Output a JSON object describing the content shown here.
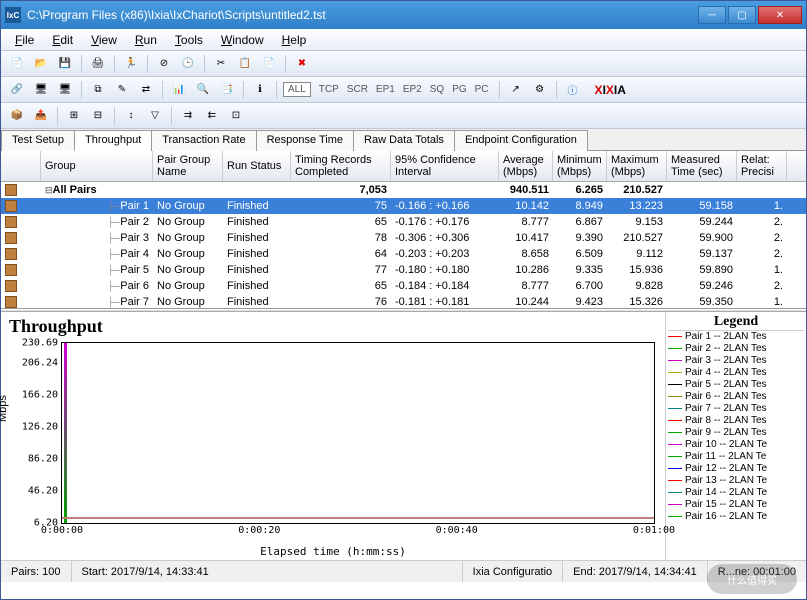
{
  "window": {
    "title": "C:\\Program Files (x86)\\Ixia\\IxChariot\\Scripts\\untitled2.tst",
    "icon_label": "IxC"
  },
  "menu": [
    "File",
    "Edit",
    "View",
    "Run",
    "Tools",
    "Window",
    "Help"
  ],
  "toolbar3": {
    "all": "ALL",
    "btns": [
      "TCP",
      "SCR",
      "EP1",
      "EP2",
      "SQ",
      "PG",
      "PC"
    ],
    "brand": "IXIA"
  },
  "tabs": [
    "Test Setup",
    "Throughput",
    "Transaction Rate",
    "Response Time",
    "Raw Data Totals",
    "Endpoint Configuration"
  ],
  "active_tab": 1,
  "grid": {
    "headers": [
      "",
      "Group",
      "Pair Group Name",
      "Run Status",
      "Timing Records Completed",
      "95% Confidence Interval",
      "Average (Mbps)",
      "Minimum (Mbps)",
      "Maximum (Mbps)",
      "Measured Time (sec)",
      "Relat: Precisi"
    ],
    "total_row": {
      "label": "All Pairs",
      "timing": "7,053",
      "avg": "940.511",
      "min": "6.265",
      "max": "210.527"
    },
    "rows": [
      {
        "g": "Pair 1",
        "pg": "No Group",
        "st": "Finished",
        "tr": "75",
        "ci": "-0.166 : +0.166",
        "avg": "10.142",
        "min": "8.949",
        "max": "13.223",
        "mt": "59.158",
        "rp": "1."
      },
      {
        "g": "Pair 2",
        "pg": "No Group",
        "st": "Finished",
        "tr": "65",
        "ci": "-0.176 : +0.176",
        "avg": "8.777",
        "min": "6.867",
        "max": "9.153",
        "mt": "59.244",
        "rp": "2."
      },
      {
        "g": "Pair 3",
        "pg": "No Group",
        "st": "Finished",
        "tr": "78",
        "ci": "-0.306 : +0.306",
        "avg": "10.417",
        "min": "9.390",
        "max": "210.527",
        "mt": "59.900",
        "rp": "2."
      },
      {
        "g": "Pair 4",
        "pg": "No Group",
        "st": "Finished",
        "tr": "64",
        "ci": "-0.203 : +0.203",
        "avg": "8.658",
        "min": "6.509",
        "max": "9.112",
        "mt": "59.137",
        "rp": "2."
      },
      {
        "g": "Pair 5",
        "pg": "No Group",
        "st": "Finished",
        "tr": "77",
        "ci": "-0.180 : +0.180",
        "avg": "10.286",
        "min": "9.335",
        "max": "15.936",
        "mt": "59.890",
        "rp": "1."
      },
      {
        "g": "Pair 6",
        "pg": "No Group",
        "st": "Finished",
        "tr": "65",
        "ci": "-0.184 : +0.184",
        "avg": "8.777",
        "min": "6.700",
        "max": "9.828",
        "mt": "59.246",
        "rp": "2."
      },
      {
        "g": "Pair 7",
        "pg": "No Group",
        "st": "Finished",
        "tr": "76",
        "ci": "-0.181 : +0.181",
        "avg": "10.244",
        "min": "9.423",
        "max": "15.326",
        "mt": "59.350",
        "rp": "1."
      }
    ]
  },
  "chart_data": {
    "type": "line",
    "title": "Throughput",
    "xlabel": "Elapsed time (h:mm:ss)",
    "ylabel": "Mbps",
    "ylim": [
      6.2,
      230.69
    ],
    "yticks": [
      230.69,
      206.24,
      166.2,
      126.2,
      86.2,
      46.2,
      6.2
    ],
    "xticks": [
      "0:00:00",
      "0:00:20",
      "0:00:40",
      "0:01:00"
    ],
    "note": "All series start with a brief spike near t=0 then settle near ~6–16 Mbps baseline for the remainder",
    "series_count": 16
  },
  "legend": {
    "title": "Legend",
    "items": [
      {
        "n": "Pair 1",
        "c": "#ff0000",
        "t": "2LAN Tes"
      },
      {
        "n": "Pair 2",
        "c": "#00aa00",
        "t": "2LAN Tes"
      },
      {
        "n": "Pair 3",
        "c": "#cc00cc",
        "t": "2LAN Tes"
      },
      {
        "n": "Pair 4",
        "c": "#aaaa00",
        "t": "2LAN Tes"
      },
      {
        "n": "Pair 5",
        "c": "#000000",
        "t": "2LAN Tes"
      },
      {
        "n": "Pair 6",
        "c": "#888800",
        "t": "2LAN Tes"
      },
      {
        "n": "Pair 7",
        "c": "#008888",
        "t": "2LAN Tes"
      },
      {
        "n": "Pair 8",
        "c": "#ff0000",
        "t": "2LAN Tes"
      },
      {
        "n": "Pair 9",
        "c": "#00aa00",
        "t": "2LAN Tes"
      },
      {
        "n": "Pair 10",
        "c": "#cc00cc",
        "t": "2LAN Te"
      },
      {
        "n": "Pair 11",
        "c": "#00aa00",
        "t": "2LAN Te"
      },
      {
        "n": "Pair 12",
        "c": "#0000ff",
        "t": "2LAN Te"
      },
      {
        "n": "Pair 13",
        "c": "#ff0000",
        "t": "2LAN Te"
      },
      {
        "n": "Pair 14",
        "c": "#008888",
        "t": "2LAN Te"
      },
      {
        "n": "Pair 15",
        "c": "#cc00cc",
        "t": "2LAN Te"
      },
      {
        "n": "Pair 16",
        "c": "#00aa00",
        "t": "2LAN Te"
      }
    ]
  },
  "status": {
    "pairs": "Pairs: 100",
    "start": "Start: 2017/9/14, 14:33:41",
    "config": "Ixia Configuratio",
    "end": "End: 2017/9/14, 14:34:41",
    "runtime": "R...ne: 00:01:00"
  },
  "watermark": "什么值得买"
}
